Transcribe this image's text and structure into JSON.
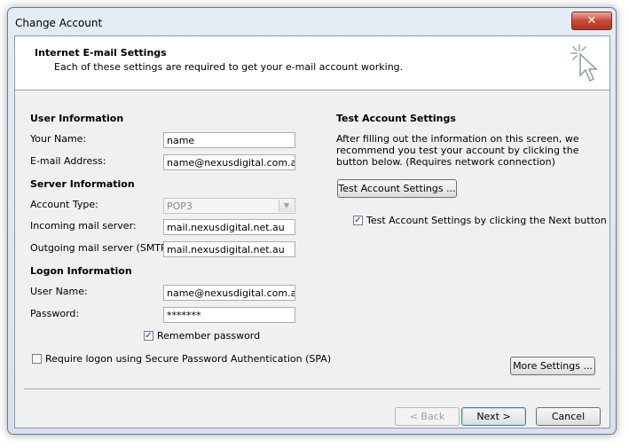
{
  "window": {
    "title": "Change Account",
    "close_glyph": "✕"
  },
  "header": {
    "title": "Internet E-mail Settings",
    "subtitle": "Each of these settings are required to get your e-mail account working.",
    "icon": "cursor-sparkle-icon"
  },
  "user_info": {
    "heading": "User Information",
    "your_name_label": "Your Name:",
    "your_name_value": "name",
    "email_label": "E-mail Address:",
    "email_value": "name@nexusdigital.com.au"
  },
  "server_info": {
    "heading": "Server Information",
    "account_type_label": "Account Type:",
    "account_type_value": "POP3",
    "incoming_label": "Incoming mail server:",
    "incoming_value": "mail.nexusdigital.net.au",
    "outgoing_label": "Outgoing mail server (SMTP):",
    "outgoing_value": "mail.nexusdigital.net.au"
  },
  "logon_info": {
    "heading": "Logon Information",
    "username_label": "User Name:",
    "username_value": "name@nexusdigital.com.au",
    "password_label": "Password:",
    "password_value": "*******",
    "remember_label": "Remember password",
    "remember_checked": true,
    "spa_label": "Require logon using Secure Password Authentication (SPA)",
    "spa_checked": false
  },
  "test": {
    "heading": "Test Account Settings",
    "description": "After filling out the information on this screen, we recommend you test your account by clicking the button below. (Requires network connection)",
    "button_label": "Test Account Settings ...",
    "auto_label": "Test Account Settings by clicking the Next button",
    "auto_checked": true
  },
  "buttons": {
    "more_settings": "More Settings ...",
    "back": "< Back",
    "next": "Next >",
    "cancel": "Cancel"
  },
  "check_glyph": "✓",
  "colors": {
    "default_button_border": "#3c7fb1",
    "close_button": "#c74a37"
  }
}
